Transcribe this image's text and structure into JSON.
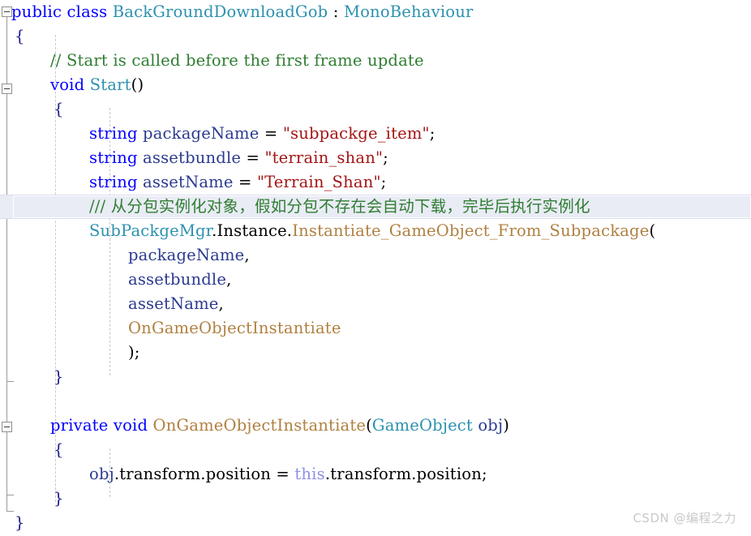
{
  "editor": {
    "language": "csharp",
    "background_color": "#ffffff",
    "highlight_line_color": "#e9ecf5",
    "indent_guide_color": "#c8c8c8",
    "outline_gutter_color": "#9a9a9a"
  },
  "palette": {
    "keyword": "#0000ff",
    "type": "#2b91af",
    "comment": "#2f7d32",
    "string": "#a31515",
    "method": "#b08040",
    "identifier": "#2b3a8f",
    "this_keyword": "#8f8fe8",
    "punctuation": "#000000",
    "brace": "#1c1c8c"
  },
  "code": {
    "line_01": {
      "kw_public_class": "public class ",
      "type_name": "BackGroundDownloadGob",
      "colon": " : ",
      "base_type": "MonoBehaviour"
    },
    "line_02": {
      "brace": "{"
    },
    "line_03": {
      "comment": "// Start is called before the first frame update"
    },
    "line_04": {
      "kw_void": "void ",
      "method": "Start",
      "parens": "()"
    },
    "line_05": {
      "brace": "{"
    },
    "line_06": {
      "kw_string": "string ",
      "ident": "packageName",
      "assign": " = ",
      "string_literal": "\"subpackge_item\"",
      "semicolon": ";"
    },
    "line_07": {
      "kw_string": "string ",
      "ident": "assetbundle",
      "assign": " = ",
      "string_literal": "\"terrain_shan\"",
      "semicolon": ";"
    },
    "line_08": {
      "kw_string": "string ",
      "ident": "assetName",
      "assign": " = ",
      "string_literal": "\"Terrain_Shan\"",
      "semicolon": ";"
    },
    "line_09": {
      "doc_comment": "/// 从分包实例化对象，假如分包不存在会自动下载，完毕后执行实例化",
      "is_highlighted": true
    },
    "line_10": {
      "type_name": "SubPackgeMgr",
      "dot_instance": ".Instance.",
      "method": "Instantiate_GameObject_From_Subpackage",
      "open_paren": "("
    },
    "line_11": {
      "arg": "packageName",
      "comma": ","
    },
    "line_12": {
      "arg": "assetbundle",
      "comma": ","
    },
    "line_13": {
      "arg": "assetName",
      "comma": ","
    },
    "line_14": {
      "arg_method": "OnGameObjectInstantiate"
    },
    "line_15": {
      "close": ");"
    },
    "line_16": {
      "brace": "}"
    },
    "line_17": {
      "blank": ""
    },
    "line_18": {
      "kw_private_void": "private void ",
      "method": "OnGameObjectInstantiate",
      "open_paren": "(",
      "param_type": "GameObject",
      "param_name": " obj",
      "close_paren": ")"
    },
    "line_19": {
      "brace": "{"
    },
    "line_20": {
      "ident_obj": "obj",
      "member_left": ".transform.position",
      "assign": " = ",
      "this_kw": "this",
      "member_right": ".transform.position",
      "semicolon": ";"
    },
    "line_21": {
      "brace": "}"
    },
    "line_22": {
      "brace": "}"
    }
  },
  "gutter": {
    "collapse_glyph": "minus",
    "regions": [
      {
        "name": "class-region",
        "collapsible": true
      },
      {
        "name": "start-method-region",
        "collapsible": true
      },
      {
        "name": "callback-method-region",
        "collapsible": true
      }
    ]
  },
  "watermark": {
    "text": "CSDN @编程之力"
  }
}
